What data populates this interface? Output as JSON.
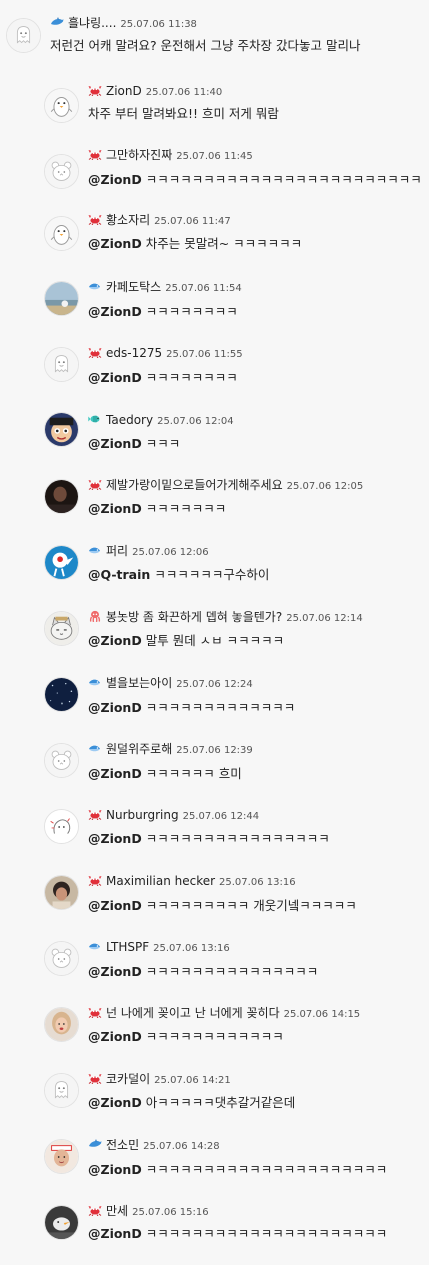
{
  "colors": {
    "background": "#f7f7f7",
    "text": "#222222",
    "time": "#555555"
  },
  "comments": [
    {
      "badge": "dolphin-icon",
      "avatar": "default-ghost",
      "nick": "흘냐링....",
      "time": "25.07.06 11:38",
      "mention": "",
      "text": "저런건 어캐 말려요? 운전해서 그냥 주차장 갔다놓고 말리나"
    },
    {
      "badge": "crab-icon",
      "avatar": "penguin",
      "nick": "ZionD",
      "time": "25.07.06 11:40",
      "mention": "",
      "text": "차주 부터 말려봐요!! 흐미 저게 뭐람"
    },
    {
      "badge": "crab-icon",
      "avatar": "default-bear",
      "nick": "그만하자진짜",
      "time": "25.07.06 11:45",
      "mention": "@ZionD",
      "text": "ㅋㅋㅋㅋㅋㅋㅋㅋㅋㅋㅋㅋㅋㅋㅋㅋㅋㅋㅋㅋㅋㅋㅋㅋ"
    },
    {
      "badge": "crab-icon",
      "avatar": "penguin",
      "nick": "황소자리",
      "time": "25.07.06 11:47",
      "mention": "@ZionD",
      "text": "차주는 못말려~ ㅋㅋㅋㅋㅋㅋ"
    },
    {
      "badge": "fish-icon",
      "avatar": "photo-sea",
      "nick": "카페도탁스",
      "time": "25.07.06 11:54",
      "mention": "@ZionD",
      "text": "ㅋㅋㅋㅋㅋㅋㅋㅋ"
    },
    {
      "badge": "crab-icon",
      "avatar": "default-ghost",
      "nick": "eds-1275",
      "time": "25.07.06 11:55",
      "mention": "@ZionD",
      "text": "ㅋㅋㅋㅋㅋㅋㅋㅋ"
    },
    {
      "badge": "tropical-fish-icon",
      "avatar": "photo-cartoon",
      "nick": "Taedory",
      "time": "25.07.06 12:04",
      "mention": "@ZionD",
      "text": "ㅋㅋㅋ"
    },
    {
      "badge": "crab-icon",
      "avatar": "photo-dark",
      "nick": "제발가랑이밑으로들어가게해주세요",
      "time": "25.07.06 12:05",
      "mention": "@ZionD",
      "text": "ㅋㅋㅋㅋㅋㅋㅋ"
    },
    {
      "badge": "fish-icon",
      "avatar": "photo-blue-bird",
      "nick": "퍼리",
      "time": "25.07.06 12:06",
      "mention": "@Q-train",
      "text": "ㅋㅋㅋㅋㅋㅋ구수하이"
    },
    {
      "badge": "octopus-icon",
      "avatar": "photo-cat",
      "nick": "봉놋방 좀 화끈하게 뎁혀 놓을텐가?",
      "time": "25.07.06 12:14",
      "mention": "@ZionD",
      "text": "말투 뭔데 ㅅㅂ ㅋㅋㅋㅋㅋ"
    },
    {
      "badge": "fish-icon",
      "avatar": "photo-night",
      "nick": "별을보는아이",
      "time": "25.07.06 12:24",
      "mention": "@ZionD",
      "text": "ㅋㅋㅋㅋㅋㅋㅋㅋㅋㅋㅋㅋㅋ"
    },
    {
      "badge": "fish-icon",
      "avatar": "default-bear",
      "nick": "원덜위주로해",
      "time": "25.07.06 12:39",
      "mention": "@ZionD",
      "text": "ㅋㅋㅋㅋㅋㅋ 흐미"
    },
    {
      "badge": "crab-icon",
      "avatar": "default-doodle",
      "nick": "Nurburgring",
      "time": "25.07.06 12:44",
      "mention": "@ZionD",
      "text": "ㅋㅋㅋㅋㅋㅋㅋㅋㅋㅋㅋㅋㅋㅋㅋㅋ"
    },
    {
      "badge": "crab-icon",
      "avatar": "photo-person",
      "nick": "Maximilian hecker",
      "time": "25.07.06 13:16",
      "mention": "@ZionD",
      "text": "ㅋㅋㅋㅋㅋㅋㅋㅋㅋ 개웃기넼ㅋㅋㅋㅋㅋ"
    },
    {
      "badge": "fish-icon",
      "avatar": "default-bear",
      "nick": "LTHSPF",
      "time": "25.07.06 13:16",
      "mention": "@ZionD",
      "text": "ㅋㅋㅋㅋㅋㅋㅋㅋㅋㅋㅋㅋㅋㅋㅋ"
    },
    {
      "badge": "crab-icon",
      "avatar": "photo-girl",
      "nick": "넌 나에게 꽂이고 난 너에게 꽂히다",
      "time": "25.07.06 14:15",
      "mention": "@ZionD",
      "text": "ㅋㅋㅋㅋㅋㅋㅋㅋㅋㅋㅋㅋ"
    },
    {
      "badge": "crab-icon",
      "avatar": "default-ghost",
      "nick": "코카덜이",
      "time": "25.07.06 14:21",
      "mention": "@ZionD",
      "text": "아ㅋㅋㅋㅋㅋ댓추갈거같은데"
    },
    {
      "badge": "dolphin-icon",
      "avatar": "photo-man",
      "nick": "전소민",
      "time": "25.07.06 14:28",
      "mention": "@ZionD",
      "text": "ㅋㅋㅋㅋㅋㅋㅋㅋㅋㅋㅋㅋㅋㅋㅋㅋㅋㅋㅋㅋㅋ"
    },
    {
      "badge": "crab-icon",
      "avatar": "photo-bird-dark",
      "nick": "만세",
      "time": "25.07.06 15:16",
      "mention": "@ZionD",
      "text": "ㅋㅋㅋㅋㅋㅋㅋㅋㅋㅋㅋㅋㅋㅋㅋㅋㅋㅋㅋㅋㅋ"
    }
  ]
}
